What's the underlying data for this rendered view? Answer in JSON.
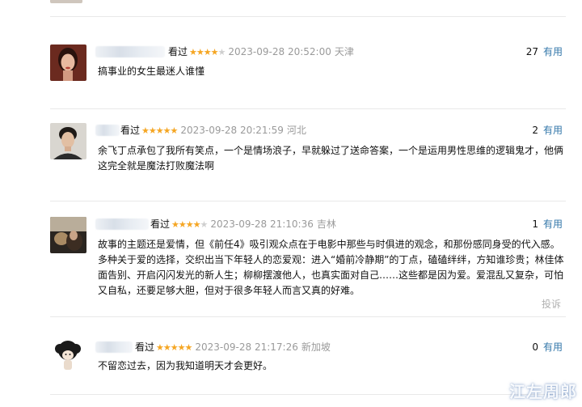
{
  "comments": [
    {
      "watched": "看过",
      "rating": 4,
      "time": "2023-09-28 20:52:00",
      "location": "天津",
      "useful_count": "27",
      "useful_label": "有用",
      "text": "搞事业的女生最迷人谁懂"
    },
    {
      "watched": "看过",
      "rating": 5,
      "time": "2023-09-28 20:21:59",
      "location": "河北",
      "useful_count": "2",
      "useful_label": "有用",
      "text": "余飞丁点承包了我所有笑点，一个是情场浪子，早就躲过了送命答案，一个是运用男性思维的逻辑鬼才，他俩这完全就是魔法打败魔法啊"
    },
    {
      "watched": "看过",
      "rating": 4,
      "time": "2023-09-28 21:10:36",
      "location": "吉林",
      "useful_count": "1",
      "useful_label": "有用",
      "text": "故事的主题还是爱情，但《前任4》吸引观众点在于电影中那些与时俱进的观念，和那份感同身受的代入感。多种关于爱的选择，交织出当下年轻人的恋爱观：进入“婚前冷静期”的丁点，磕磕绊绊，方知谁珍贵；林佳体面告别、开启闪闪发光的新人生；柳柳摆渡他人，也真实面对自己……这些都是因为爱。爱混乱又复杂，可怕又自私，还要足够大胆，但对于很多年轻人而言又真的好难。",
      "report_label": "投诉"
    },
    {
      "watched": "看过",
      "rating": 5,
      "time": "2023-09-28 21:17:26",
      "location": "新加坡",
      "useful_count": "0",
      "useful_label": "有用",
      "text": "不留恋过去，因为我知道明天才会更好。"
    }
  ],
  "watermark": "江左周郎",
  "colors": {
    "star": "#f5a623",
    "star_off": "#cfcfcf",
    "link": "#3377aa",
    "meta_gray": "#9a9a9a"
  }
}
